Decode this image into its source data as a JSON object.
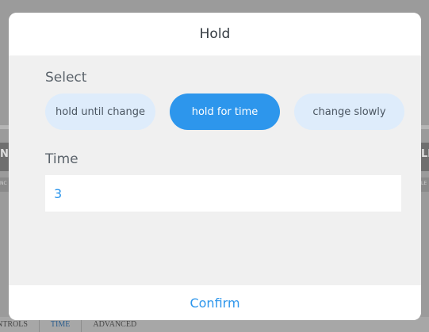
{
  "background": {
    "edge_left_text": "N",
    "edge_right_text": "LI",
    "edge_left_small": "NC",
    "edge_right_small": "LE",
    "bottom_tabs": [
      {
        "label": "NTROLS"
      },
      {
        "label": "TIME"
      },
      {
        "label": "ADVANCED"
      }
    ]
  },
  "dialog": {
    "title": "Hold",
    "select_label": "Select",
    "options": [
      {
        "label": "hold until change",
        "selected": false
      },
      {
        "label": "hold for time",
        "selected": true
      },
      {
        "label": "change slowly",
        "selected": false
      }
    ],
    "time_label": "Time",
    "time_value": "3",
    "confirm_label": "Confirm"
  },
  "colors": {
    "accent": "#2d96ec",
    "option_bg": "#deecfb",
    "body_bg": "#f0f0f0"
  }
}
